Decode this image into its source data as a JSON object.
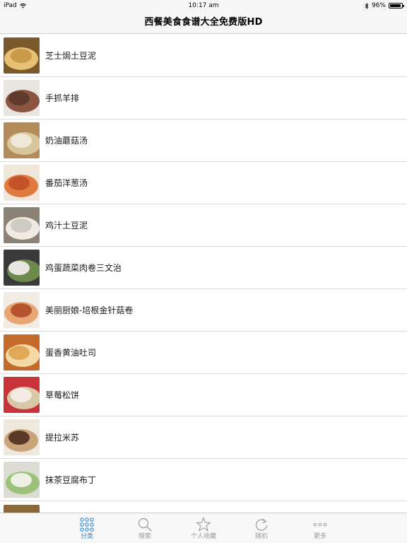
{
  "status_bar": {
    "device": "iPad",
    "time": "10:17 am",
    "battery_text": "96%",
    "battery_level": 0.96
  },
  "nav": {
    "title": "西餐美食食谱大全免费版HD"
  },
  "recipes": [
    {
      "label": "芝士焗土豆泥",
      "colors": [
        "#c99a4a",
        "#e8c074",
        "#7a5a2a"
      ]
    },
    {
      "label": "手抓羊排",
      "colors": [
        "#5e3b2a",
        "#8a5640",
        "#e9e6e2"
      ]
    },
    {
      "label": "奶油蘑菇汤",
      "colors": [
        "#efe8d6",
        "#d9c59a",
        "#b48b5a"
      ]
    },
    {
      "label": "番茄洋葱汤",
      "colors": [
        "#c4532a",
        "#e07a40",
        "#f1e6da"
      ]
    },
    {
      "label": "鸡汁土豆泥",
      "colors": [
        "#cfcac2",
        "#efeae3",
        "#8c8375"
      ]
    },
    {
      "label": "鸡蛋蔬菜肉卷三文治",
      "colors": [
        "#e9e7e3",
        "#6d8a4c",
        "#3a3a3a"
      ]
    },
    {
      "label": "美丽厨娘-培根金针菇卷",
      "colors": [
        "#b5532f",
        "#e8a673",
        "#f3ece4"
      ]
    },
    {
      "label": "蛋香黄油吐司",
      "colors": [
        "#e0a857",
        "#f3d9a5",
        "#c46a2a"
      ]
    },
    {
      "label": "草莓松饼",
      "colors": [
        "#f2ece4",
        "#d9c8a8",
        "#c8343a"
      ]
    },
    {
      "label": "提拉米苏",
      "colors": [
        "#5a3a26",
        "#c9a37a",
        "#efe8dc"
      ]
    },
    {
      "label": "抹茶豆腐布丁",
      "colors": [
        "#eef0e6",
        "#9cc27a",
        "#dcdcd2"
      ]
    },
    {
      "label": "",
      "colors": [
        "#c7b08a",
        "#e6dcc6",
        "#8a6a3a"
      ]
    }
  ],
  "tabs": [
    {
      "label": "分类",
      "icon": "grid-dots-icon",
      "active": true
    },
    {
      "label": "搜索",
      "icon": "search-icon",
      "active": false
    },
    {
      "label": "个人收藏",
      "icon": "star-icon",
      "active": false
    },
    {
      "label": "随机",
      "icon": "refresh-icon",
      "active": false
    },
    {
      "label": "更多",
      "icon": "more-dots-icon",
      "active": false
    }
  ],
  "colors": {
    "accent": "#2a89d8",
    "inactive": "#9a9a9a"
  }
}
